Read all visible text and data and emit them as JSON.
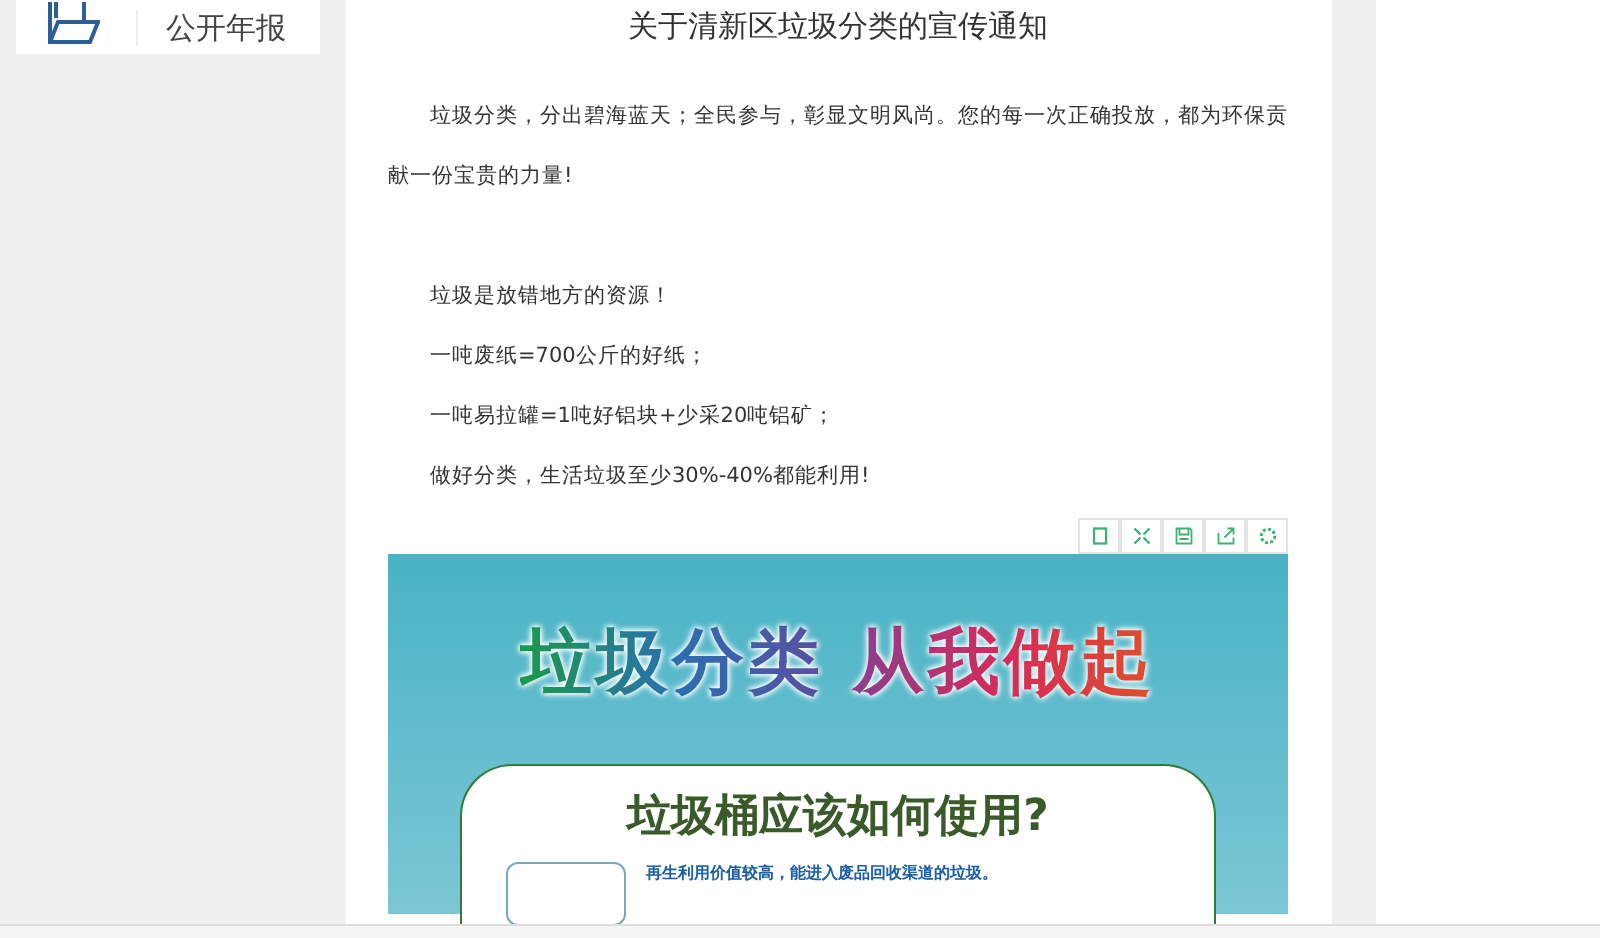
{
  "sidebar_card": {
    "label": "公开年报"
  },
  "article": {
    "title": "关于清新区垃圾分类的宣传通知",
    "intro": "垃圾分类，分出碧海蓝天；全民参与，彰显文明风尚。您的每一次正确投放，都为环保贡献一份宝贵的力量!",
    "paragraphs": [
      "垃圾是放错地方的资源！",
      "一吨废纸=700公斤的好纸；",
      "一吨易拉罐=1吨好铝块+少采20吨铝矿；",
      "做好分类，生活垃圾至少30%-40%都能利用!"
    ],
    "poster": {
      "headline": [
        "垃圾分类",
        "从我做起"
      ],
      "card_title": "垃圾桶应该如何使用?",
      "card_text": "再生利用价值较高，能进入废品回收渠道的垃圾。"
    }
  }
}
